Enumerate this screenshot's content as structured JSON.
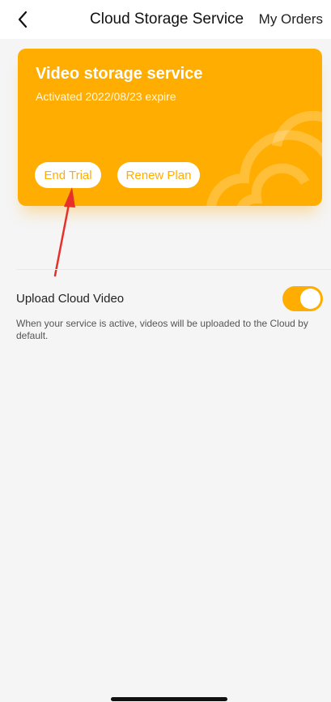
{
  "header": {
    "back_icon": "chevron-left-icon",
    "title": "Cloud Storage Service",
    "action_label": "My Orders"
  },
  "card": {
    "title": "Video storage service",
    "subtitle": "Activated 2022/08/23 expire",
    "end_trial_label": "End Trial",
    "renew_plan_label": "Renew Plan",
    "background_color": "#ffad00",
    "decoration_icon": "cloud-icon"
  },
  "annotation": {
    "icon": "red-arrow-icon",
    "color": "#e8302a"
  },
  "settings": {
    "upload_cloud_video": {
      "label": "Upload Cloud Video",
      "enabled": true,
      "description": "When your service is active, videos will be uploaded to the Cloud by default."
    }
  },
  "colors": {
    "accent": "#ffad00",
    "background": "#f5f5f5"
  }
}
